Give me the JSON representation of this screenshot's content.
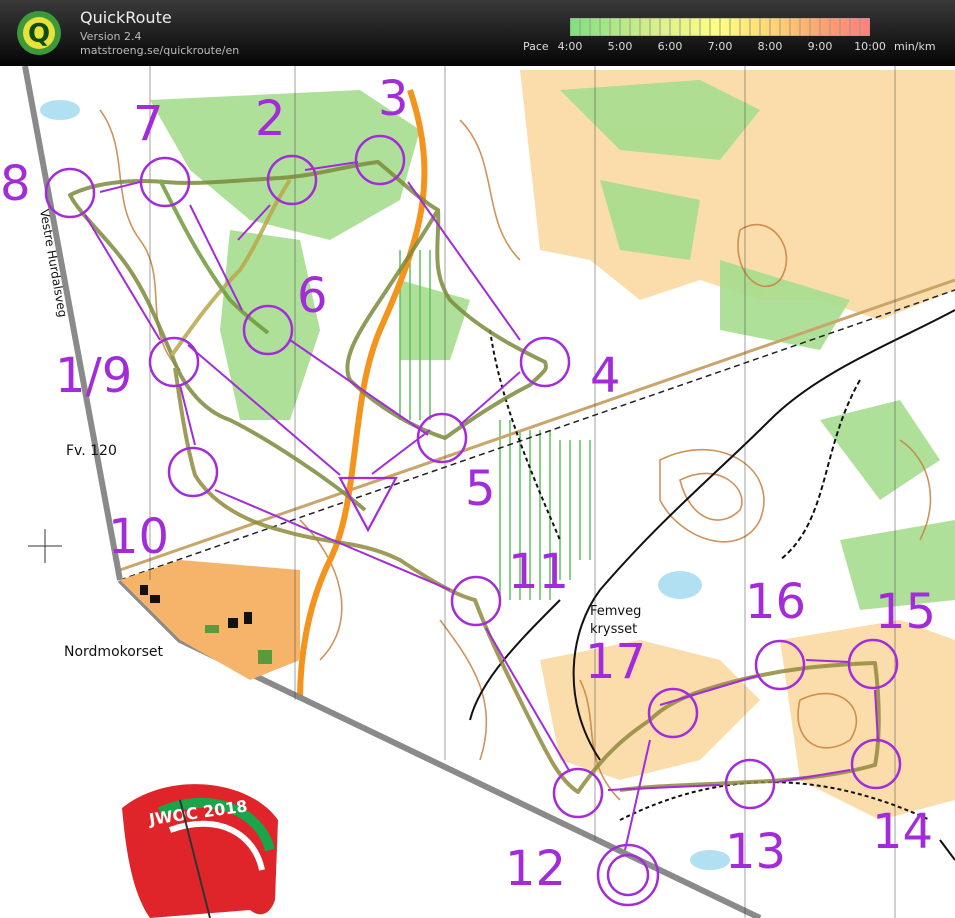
{
  "app": {
    "title": "QuickRoute",
    "version": "Version 2.4",
    "url": "matstroeng.se/quickroute/en",
    "logo_letter": "Q"
  },
  "pace_legend": {
    "label": "Pace",
    "ticks": [
      "4:00",
      "5:00",
      "6:00",
      "7:00",
      "8:00",
      "9:00",
      "10:00"
    ],
    "unit": "min/km",
    "colors": [
      "#7fe07f",
      "#c8e87f",
      "#ffff80",
      "#ffcf70",
      "#ff9f70",
      "#ff7f7f"
    ]
  },
  "map_labels": {
    "road_left": "Vestre Hurdalsveg",
    "fv": "Fv. 120",
    "nordmokorset": "Nordmokorset",
    "femveg_1": "Femveg",
    "femveg_2": "krysset"
  },
  "controls": [
    {
      "label": "1/9"
    },
    {
      "label": "2"
    },
    {
      "label": "3"
    },
    {
      "label": "4"
    },
    {
      "label": "5"
    },
    {
      "label": "6"
    },
    {
      "label": "7"
    },
    {
      "label": "8"
    },
    {
      "label": "10"
    },
    {
      "label": "11"
    },
    {
      "label": "12"
    },
    {
      "label": "13"
    },
    {
      "label": "14"
    },
    {
      "label": "15"
    },
    {
      "label": "16"
    },
    {
      "label": "17"
    }
  ],
  "logo_text": "JWOC 2018",
  "colors": {
    "course": "#a32cd9",
    "route": "#8a7a3c",
    "forest_green": "#a6dd8e",
    "open_land": "#fbd9a3",
    "road_orange": "#f5941d"
  }
}
